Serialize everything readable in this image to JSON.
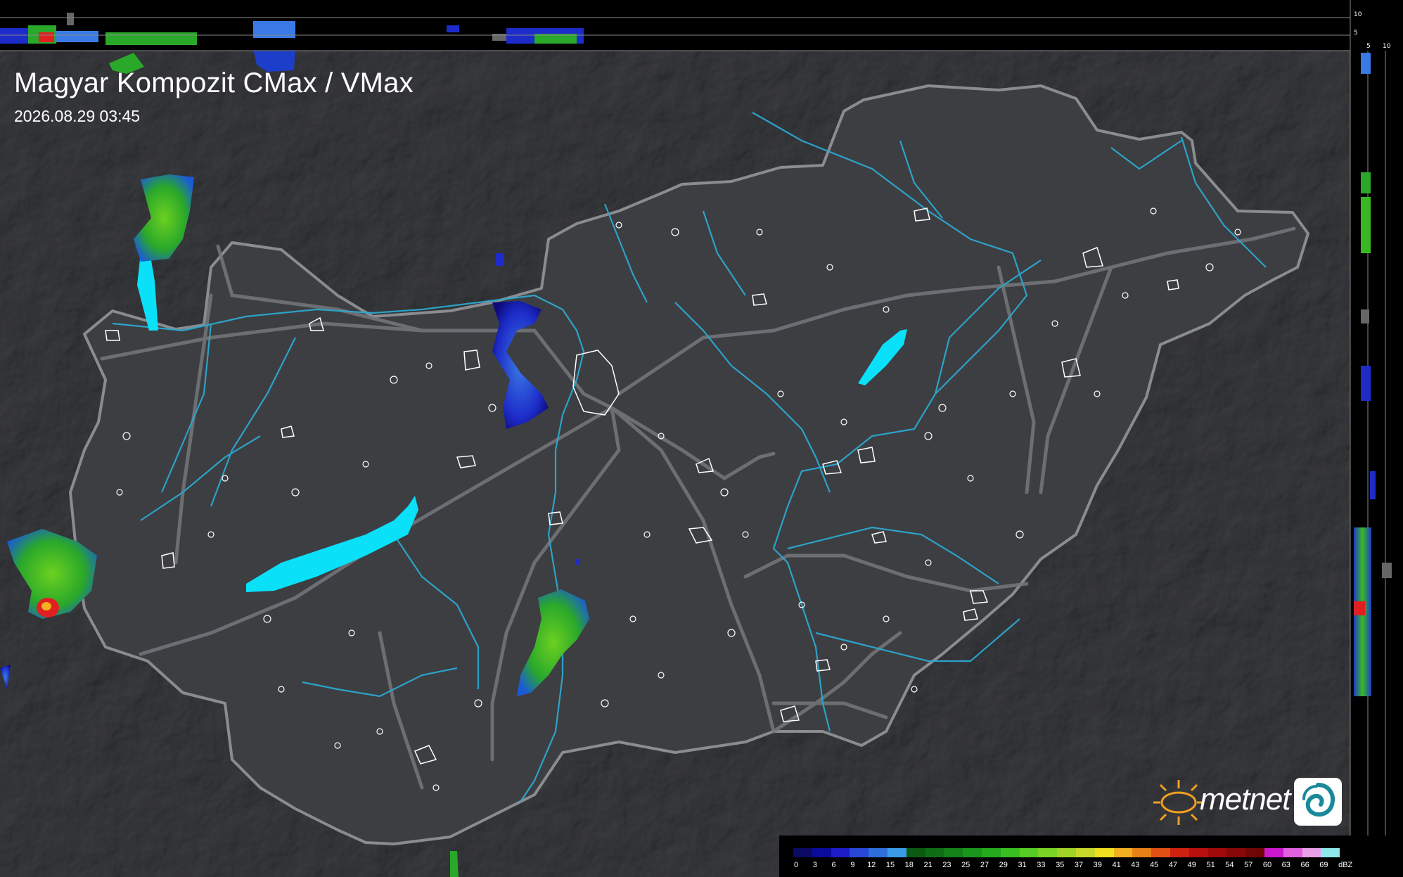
{
  "title": "Magyar Kompozit CMax / VMax",
  "timestamp": "2026.08.29 03:45",
  "side_panel": {
    "top_ticks": [
      "10",
      "5"
    ],
    "right_ticks": [
      "5",
      "10"
    ]
  },
  "legend": {
    "unit": "dBZ",
    "levels": [
      "0",
      "3",
      "6",
      "9",
      "12",
      "15",
      "18",
      "21",
      "23",
      "25",
      "27",
      "29",
      "31",
      "33",
      "35",
      "37",
      "39",
      "41",
      "43",
      "45",
      "47",
      "49",
      "51",
      "54",
      "57",
      "60",
      "63",
      "66",
      "69"
    ],
    "colors": [
      "#0b0b64",
      "#0a0a9c",
      "#1d1dc8",
      "#2747d6",
      "#2e6fde",
      "#3a9ce6",
      "#0a5a12",
      "#0e6e14",
      "#148218",
      "#1b961c",
      "#25aa1f",
      "#3abe22",
      "#57cc24",
      "#7ad526",
      "#a2d228",
      "#c8d82a",
      "#f0e020",
      "#f0b020",
      "#e88018",
      "#e05014",
      "#d02010",
      "#b8100c",
      "#a00a0a",
      "#880808",
      "#700606",
      "#cc18cc",
      "#e060e0",
      "#e8a0e8",
      "#8ee8e8"
    ]
  },
  "brand": {
    "name": "metnet",
    "colors": {
      "sun": "#f0a020",
      "badge": "#1a8a9a"
    }
  },
  "map_colors": {
    "background": "#2c2d30",
    "country_fill": "#3d3e42",
    "border": "#8a8c90",
    "rivers": "#2ca8d0",
    "lakes": "#0ae0f8",
    "roads": "#75777b"
  }
}
